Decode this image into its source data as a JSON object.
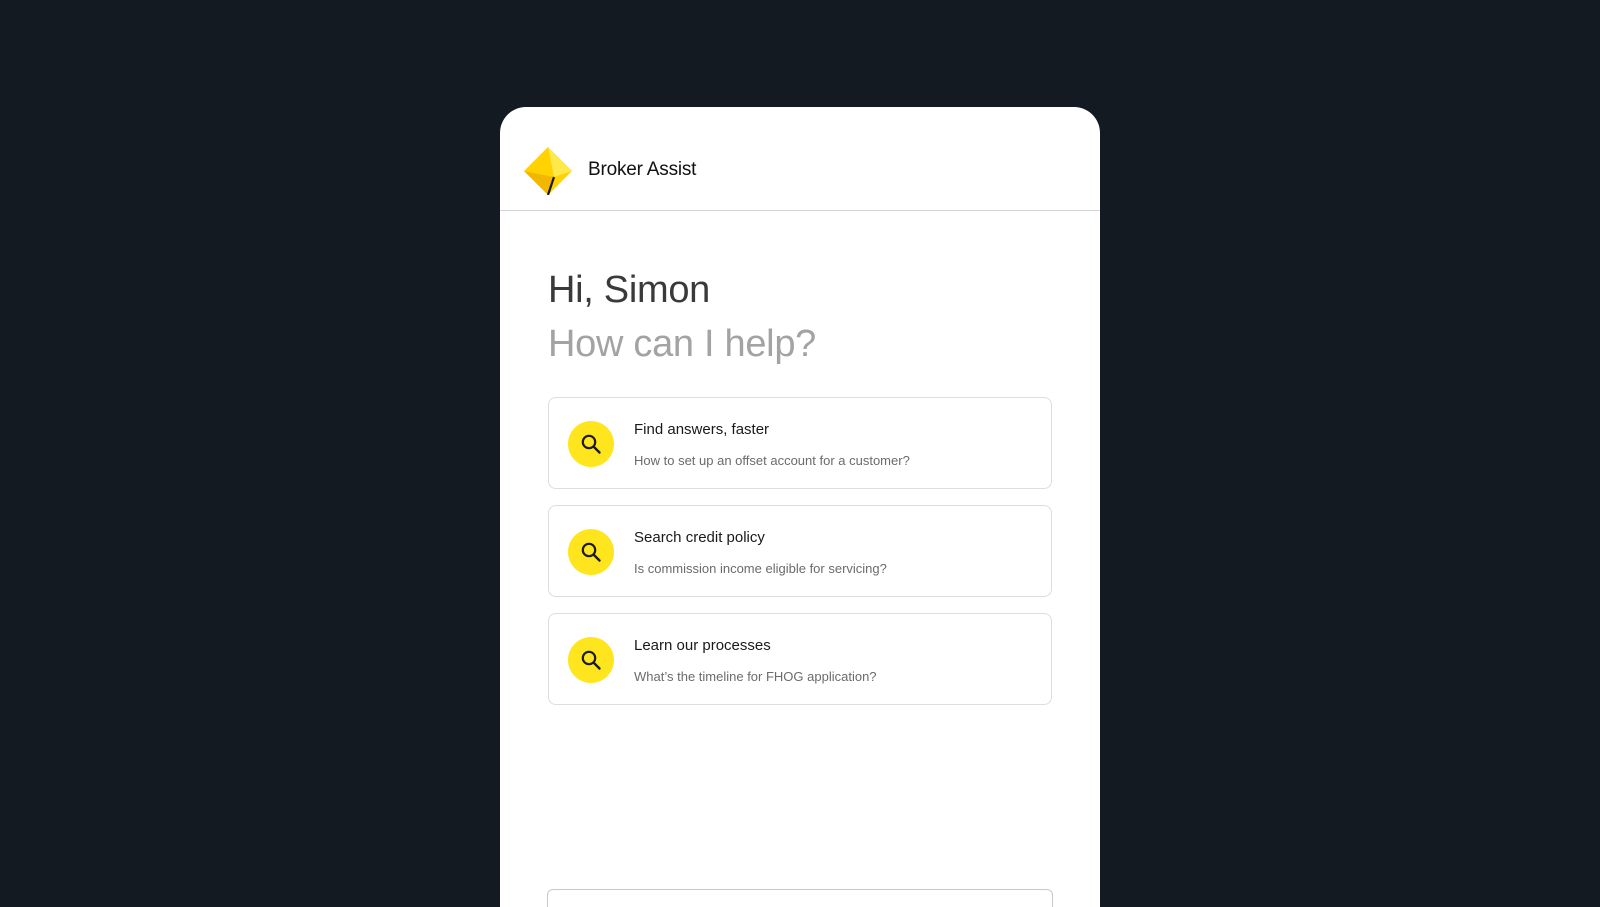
{
  "header": {
    "logo_icon": "diamond-logo-icon",
    "title": "Broker Assist"
  },
  "greeting": {
    "line1": "Hi, Simon",
    "line2": "How can I help?"
  },
  "suggestions": [
    {
      "icon": "search-icon",
      "title": "Find answers, faster",
      "example": "How to set up an offset account for a customer?"
    },
    {
      "icon": "search-icon",
      "title": "Search credit policy",
      "example": "Is commission income eligible for servicing?"
    },
    {
      "icon": "search-icon",
      "title": "Learn our processes",
      "example": "What’s the timeline for FHOG application?"
    }
  ],
  "colors": {
    "background": "#141a21",
    "accent_yellow": "#ffe51e",
    "panel": "#ffffff"
  }
}
